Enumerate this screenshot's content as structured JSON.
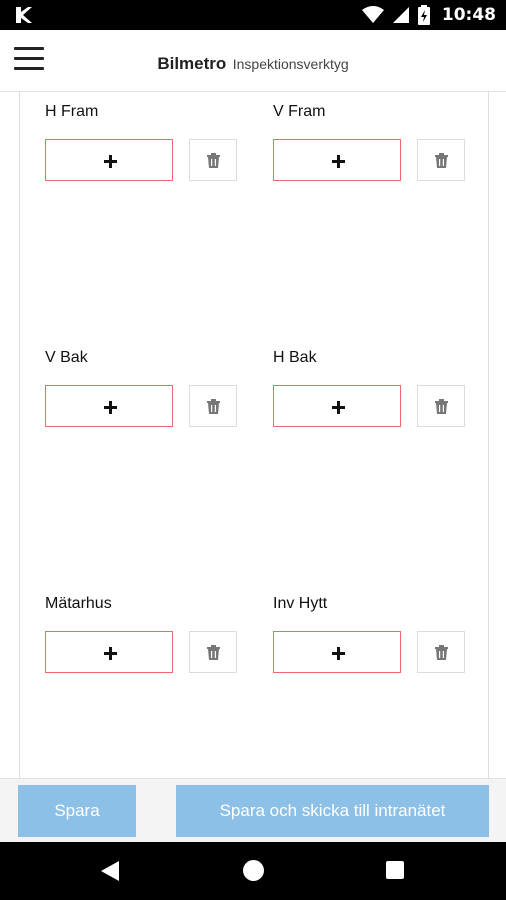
{
  "status_bar": {
    "time": "10:48",
    "app_icon": "app-notification-icon",
    "icons": [
      "wifi-icon",
      "signal-icon",
      "battery-icon"
    ]
  },
  "header": {
    "brand": "Bilmetro",
    "subtitle": "Inspektionsverktyg",
    "menu_icon": "hamburger-menu-icon"
  },
  "slots": [
    {
      "label": "H Fram",
      "add_icon": "plus-icon",
      "delete_icon": "trash-icon"
    },
    {
      "label": "V Fram",
      "add_icon": "plus-icon",
      "delete_icon": "trash-icon"
    },
    {
      "label": "V Bak",
      "add_icon": "plus-icon",
      "delete_icon": "trash-icon"
    },
    {
      "label": "H Bak",
      "add_icon": "plus-icon",
      "delete_icon": "trash-icon"
    },
    {
      "label": "Mätarhus",
      "add_icon": "plus-icon",
      "delete_icon": "trash-icon"
    },
    {
      "label": "Inv Hytt",
      "add_icon": "plus-icon",
      "delete_icon": "trash-icon"
    }
  ],
  "actions": {
    "save_label": "Spara",
    "send_label": "Spara och skicka till intranätet"
  },
  "colors": {
    "accent_button": "#8cc0e6",
    "add_border": "#ef6a6a"
  }
}
